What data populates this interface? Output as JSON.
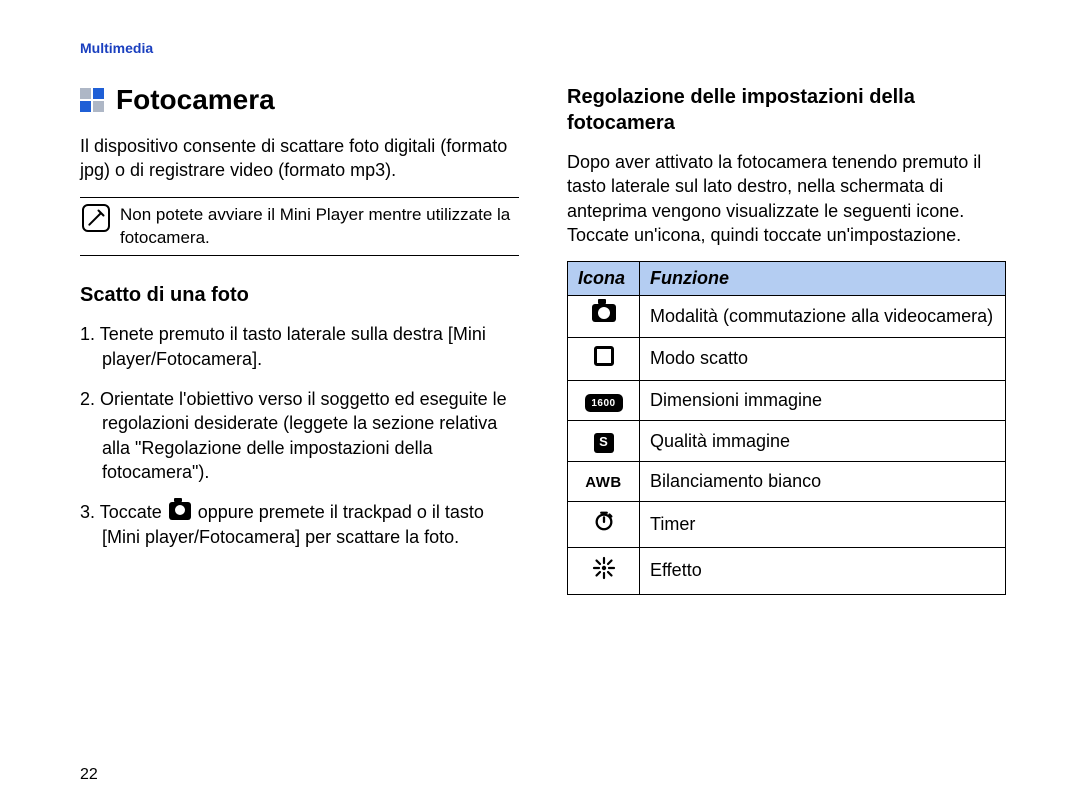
{
  "header": {
    "section": "Multimedia"
  },
  "left": {
    "title": "Fotocamera",
    "intro": "Il dispositivo consente di scattare foto digitali (formato jpg) o di registrare video (formato mp3).",
    "note": "Non potete avviare il Mini Player mentre utilizzate la fotocamera.",
    "subhead": "Scatto di una foto",
    "steps": {
      "s1": "1. Tenete premuto il tasto laterale sulla destra [Mini player/Fotocamera].",
      "s2": "2. Orientate l'obiettivo verso il soggetto ed eseguite le regolazioni desiderate (leggete la sezione relativa alla \"Regolazione delle impostazioni della fotocamera\").",
      "s3a": "3. Toccate ",
      "s3b": " oppure premete il trackpad o il tasto [Mini player/Fotocamera] per scattare la foto."
    }
  },
  "right": {
    "subhead": "Regolazione delle impostazioni della fotocamera",
    "intro": "Dopo aver attivato la fotocamera tenendo premuto il tasto laterale sul lato destro, nella schermata di anteprima vengono visualizzate le seguenti icone. Toccate un'icona, quindi toccate un'impostazione.",
    "table": {
      "col1": "Icona",
      "col2": "Funzione",
      "resBadge": "1600",
      "sBadge": "S",
      "awb": "AWB",
      "rows": {
        "r1": "Modalità (commutazione alla videocamera)",
        "r2": "Modo scatto",
        "r3": "Dimensioni immagine",
        "r4": "Qualità immagine",
        "r5": "Bilanciamento bianco",
        "r6": "Timer",
        "r7": "Effetto"
      }
    }
  },
  "page_number": "22"
}
